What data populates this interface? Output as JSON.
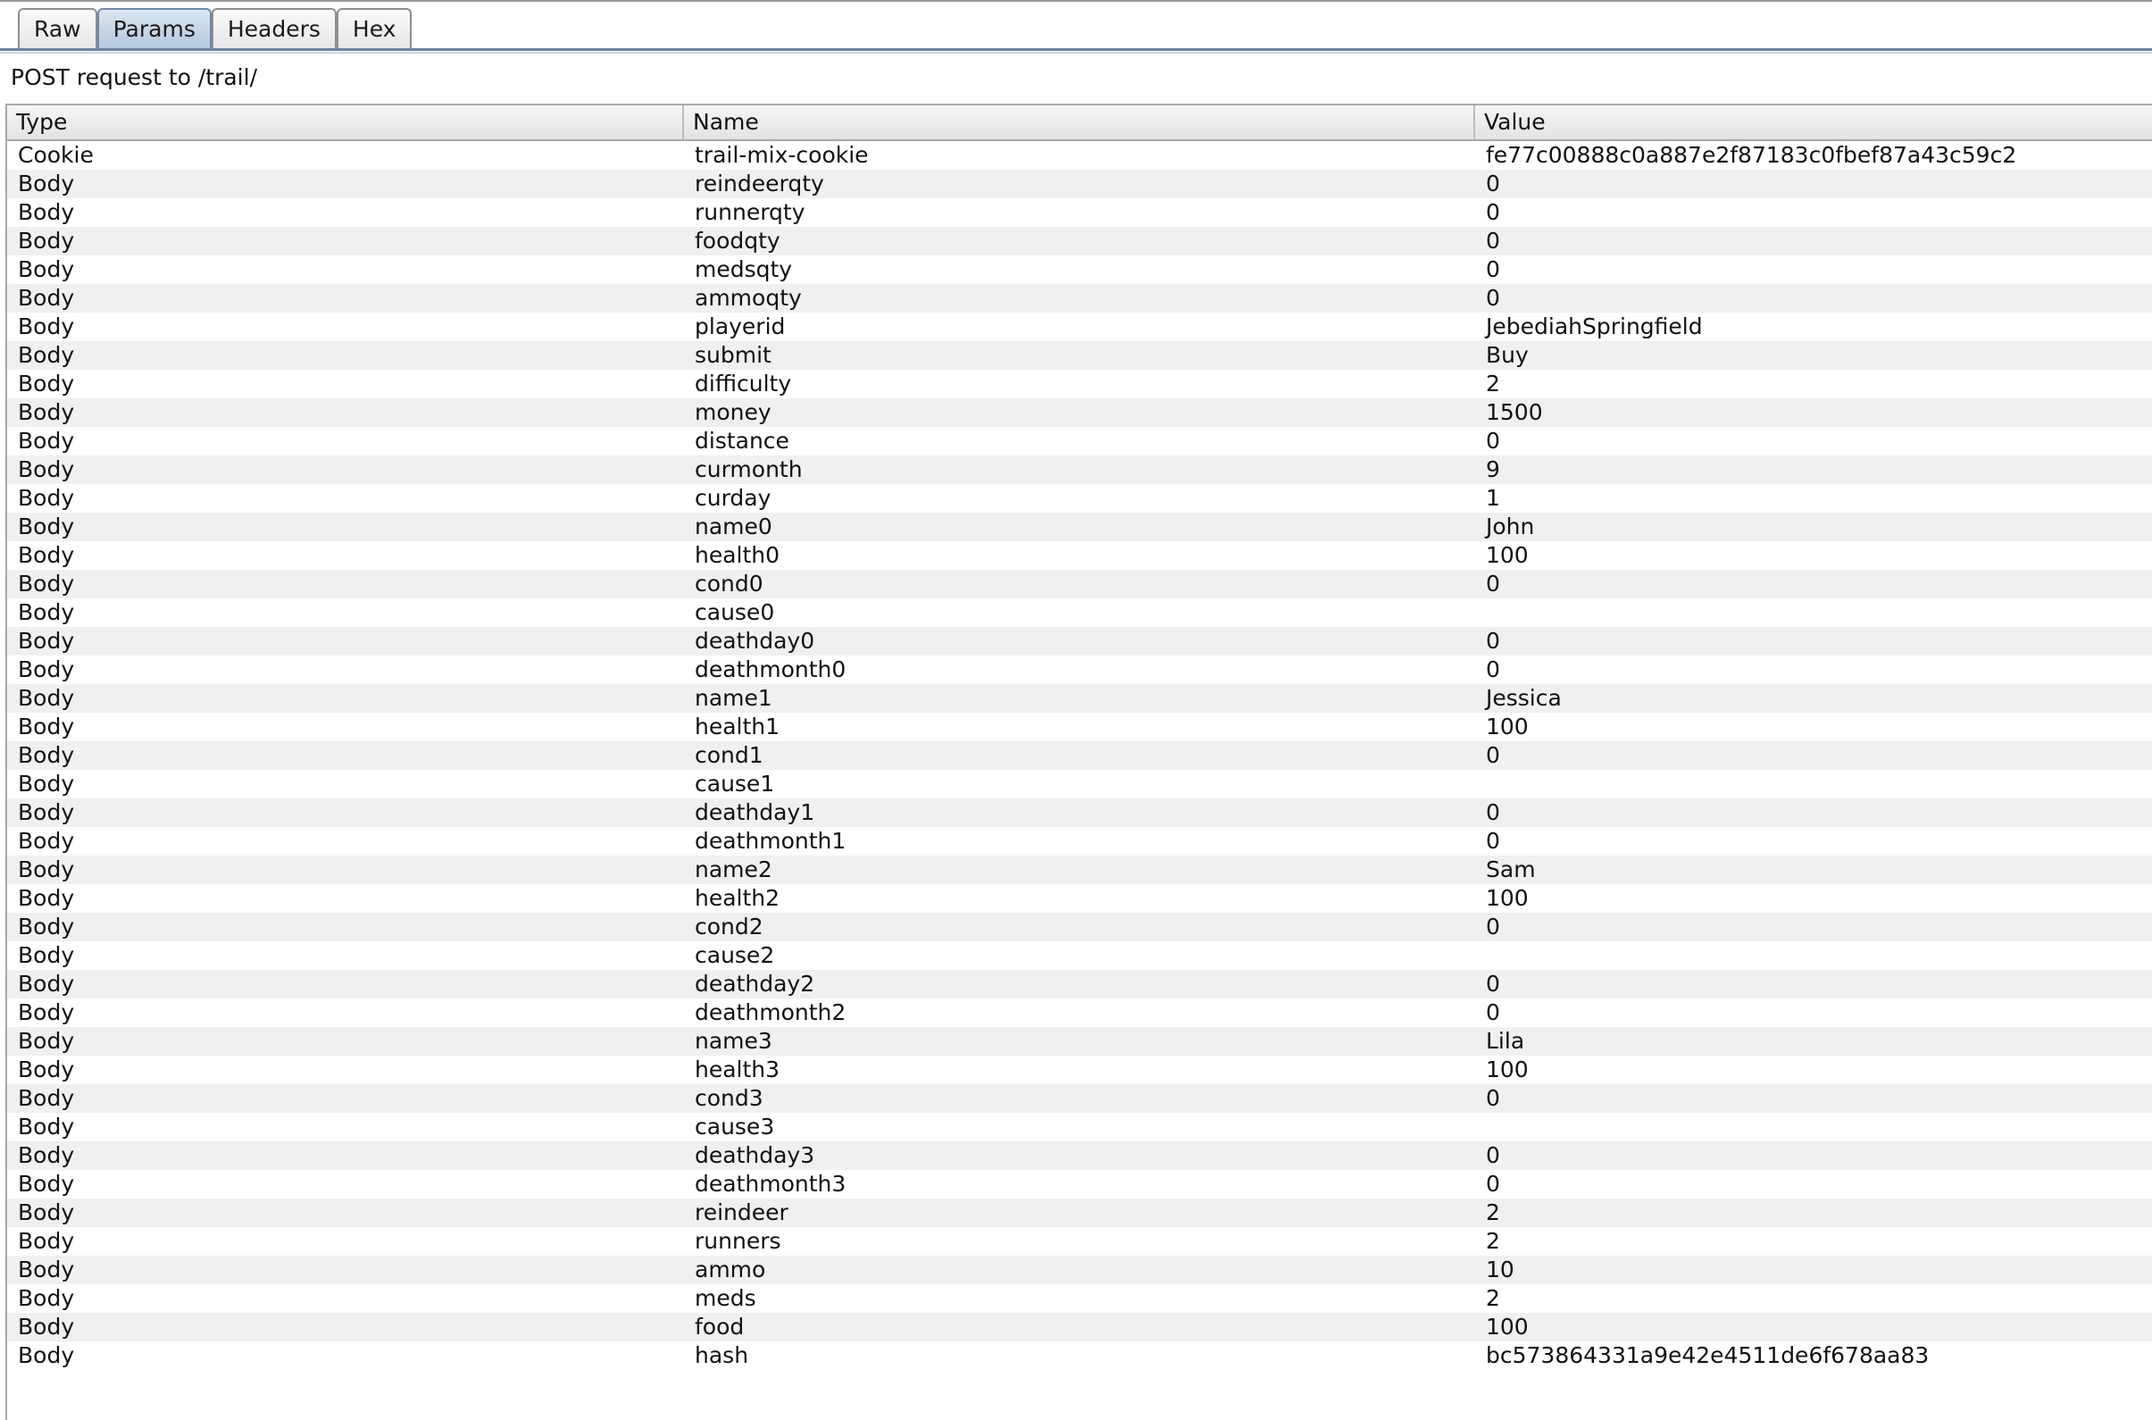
{
  "tabs": [
    "Raw",
    "Params",
    "Headers",
    "Hex"
  ],
  "active_tab": "Params",
  "request_line": "POST request to /trail/",
  "table": {
    "headers": [
      "Type",
      "Name",
      "Value"
    ],
    "rows": [
      {
        "type": "Cookie",
        "name": "trail-mix-cookie",
        "value": "fe77c00888c0a887e2f87183c0fbef87a43c59c2"
      },
      {
        "type": "Body",
        "name": "reindeerqty",
        "value": "0"
      },
      {
        "type": "Body",
        "name": "runnerqty",
        "value": "0"
      },
      {
        "type": "Body",
        "name": "foodqty",
        "value": "0"
      },
      {
        "type": "Body",
        "name": "medsqty",
        "value": "0"
      },
      {
        "type": "Body",
        "name": "ammoqty",
        "value": "0"
      },
      {
        "type": "Body",
        "name": "playerid",
        "value": "JebediahSpringfield"
      },
      {
        "type": "Body",
        "name": "submit",
        "value": "Buy"
      },
      {
        "type": "Body",
        "name": "difficulty",
        "value": "2"
      },
      {
        "type": "Body",
        "name": "money",
        "value": "1500"
      },
      {
        "type": "Body",
        "name": "distance",
        "value": "0"
      },
      {
        "type": "Body",
        "name": "curmonth",
        "value": "9"
      },
      {
        "type": "Body",
        "name": "curday",
        "value": "1"
      },
      {
        "type": "Body",
        "name": "name0",
        "value": "John"
      },
      {
        "type": "Body",
        "name": "health0",
        "value": "100"
      },
      {
        "type": "Body",
        "name": "cond0",
        "value": "0"
      },
      {
        "type": "Body",
        "name": "cause0",
        "value": ""
      },
      {
        "type": "Body",
        "name": "deathday0",
        "value": "0"
      },
      {
        "type": "Body",
        "name": "deathmonth0",
        "value": "0"
      },
      {
        "type": "Body",
        "name": "name1",
        "value": "Jessica"
      },
      {
        "type": "Body",
        "name": "health1",
        "value": "100"
      },
      {
        "type": "Body",
        "name": "cond1",
        "value": "0"
      },
      {
        "type": "Body",
        "name": "cause1",
        "value": ""
      },
      {
        "type": "Body",
        "name": "deathday1",
        "value": "0"
      },
      {
        "type": "Body",
        "name": "deathmonth1",
        "value": "0"
      },
      {
        "type": "Body",
        "name": "name2",
        "value": "Sam"
      },
      {
        "type": "Body",
        "name": "health2",
        "value": "100"
      },
      {
        "type": "Body",
        "name": "cond2",
        "value": "0"
      },
      {
        "type": "Body",
        "name": "cause2",
        "value": ""
      },
      {
        "type": "Body",
        "name": "deathday2",
        "value": "0"
      },
      {
        "type": "Body",
        "name": "deathmonth2",
        "value": "0"
      },
      {
        "type": "Body",
        "name": "name3",
        "value": "Lila"
      },
      {
        "type": "Body",
        "name": "health3",
        "value": "100"
      },
      {
        "type": "Body",
        "name": "cond3",
        "value": "0"
      },
      {
        "type": "Body",
        "name": "cause3",
        "value": ""
      },
      {
        "type": "Body",
        "name": "deathday3",
        "value": "0"
      },
      {
        "type": "Body",
        "name": "deathmonth3",
        "value": "0"
      },
      {
        "type": "Body",
        "name": "reindeer",
        "value": "2"
      },
      {
        "type": "Body",
        "name": "runners",
        "value": "2"
      },
      {
        "type": "Body",
        "name": "ammo",
        "value": "10"
      },
      {
        "type": "Body",
        "name": "meds",
        "value": "2"
      },
      {
        "type": "Body",
        "name": "food",
        "value": "100"
      },
      {
        "type": "Body",
        "name": "hash",
        "value": "bc573864331a9e42e4511de6f678aa83"
      }
    ]
  }
}
